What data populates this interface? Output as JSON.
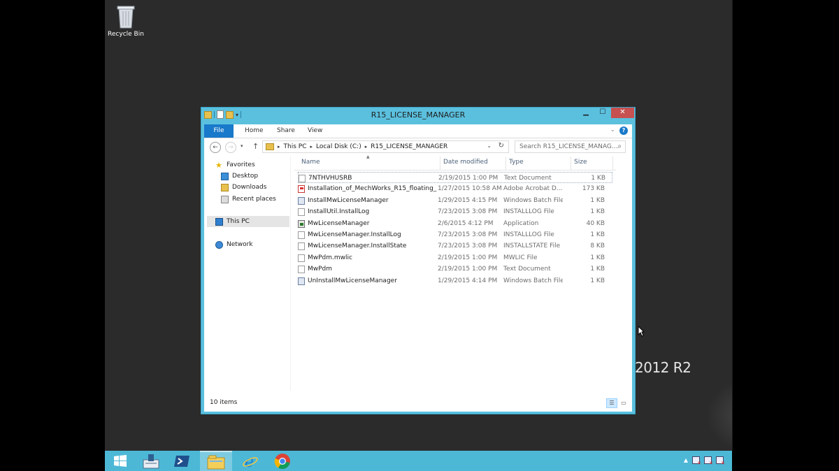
{
  "desktop": {
    "recycle_bin_label": "Recycle Bin",
    "edition_text": "2012 R2"
  },
  "window": {
    "title": "R15_LICENSE_MANAGER",
    "controls": {
      "minimize": "▁",
      "maximize": "☐",
      "close": "✕"
    }
  },
  "ribbon": {
    "tabs": [
      "File",
      "Home",
      "Share",
      "View"
    ],
    "help_label": "?",
    "expand_label": "⌄"
  },
  "navbar": {
    "back_icon": "←",
    "forward_icon": "→",
    "recent_icon": "▾",
    "up_icon": "↑",
    "breadcrumb": [
      "This PC",
      "Local Disk (C:)",
      "R15_LICENSE_MANAGER"
    ],
    "breadcrumb_sep": "▸",
    "refresh_icon": "↻",
    "dropdown_icon": "⌄",
    "search_placeholder": "Search R15_LICENSE_MANAG...",
    "search_icon": "⌕"
  },
  "navpane": {
    "favorites": "Favorites",
    "desktop": "Desktop",
    "downloads": "Downloads",
    "recent_places": "Recent places",
    "this_pc": "This PC",
    "network": "Network"
  },
  "columns": {
    "name": "Name",
    "date": "Date modified",
    "type": "Type",
    "size": "Size"
  },
  "files": [
    {
      "name": "7NTHVHUSRB",
      "date": "2/19/2015 1:00 PM",
      "type": "Text Document",
      "size": "1 KB",
      "icon": "text"
    },
    {
      "name": "Installation_of_MechWorks_R15_floating_...",
      "date": "1/27/2015 10:58 AM",
      "type": "Adobe Acrobat D...",
      "size": "173 KB",
      "icon": "pdf"
    },
    {
      "name": "InstallMwLicenseManager",
      "date": "1/29/2015 4:15 PM",
      "type": "Windows Batch File",
      "size": "1 KB",
      "icon": "bat"
    },
    {
      "name": "InstallUtil.InstallLog",
      "date": "7/23/2015 3:08 PM",
      "type": "INSTALLLOG File",
      "size": "1 KB",
      "icon": "text"
    },
    {
      "name": "MwLicenseManager",
      "date": "2/6/2015 4:12 PM",
      "type": "Application",
      "size": "40 KB",
      "icon": "app"
    },
    {
      "name": "MwLicenseManager.InstallLog",
      "date": "7/23/2015 3:08 PM",
      "type": "INSTALLLOG File",
      "size": "1 KB",
      "icon": "text"
    },
    {
      "name": "MwLicenseManager.InstallState",
      "date": "7/23/2015 3:08 PM",
      "type": "INSTALLSTATE File",
      "size": "8 KB",
      "icon": "text"
    },
    {
      "name": "MwPdm.mwlic",
      "date": "2/19/2015 1:00 PM",
      "type": "MWLIC File",
      "size": "1 KB",
      "icon": "text"
    },
    {
      "name": "MwPdm",
      "date": "2/19/2015 1:00 PM",
      "type": "Text Document",
      "size": "1 KB",
      "icon": "text"
    },
    {
      "name": "UnInstallMwLicenseManager",
      "date": "1/29/2015 4:14 PM",
      "type": "Windows Batch File",
      "size": "1 KB",
      "icon": "bat"
    }
  ],
  "status": {
    "item_count": "10 items",
    "details_view_icon": "☰",
    "tiles_view_icon": "▭"
  },
  "taskbar": {
    "apps": [
      "start",
      "server-manager",
      "powershell",
      "file-explorer",
      "internet-explorer",
      "chrome"
    ],
    "tray_expand_icon": "▲"
  }
}
